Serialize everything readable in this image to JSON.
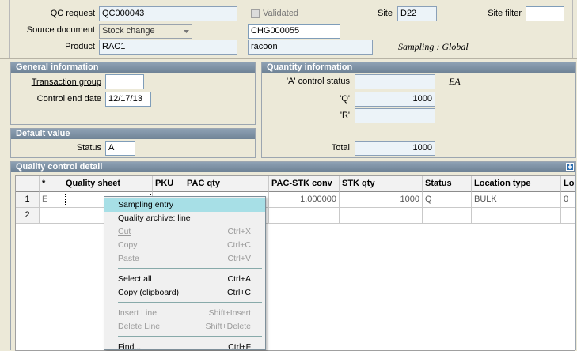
{
  "header": {
    "qc_request_label": "QC request",
    "qc_request_value": "QC000043",
    "validated_label": "Validated",
    "site_label": "Site",
    "site_value": "D22",
    "site_filter_label": "Site filter",
    "site_filter_value": "",
    "source_document_label": "Source document",
    "source_document_value": "Stock change",
    "source_ref_value": "CHG000055",
    "product_label": "Product",
    "product_value": "RAC1",
    "product_desc": "racoon",
    "sampling_text": "Sampling : Global"
  },
  "general_information": {
    "title": "General information",
    "transaction_group_label": "Transaction group",
    "transaction_group_value": "",
    "control_end_date_label": "Control end date",
    "control_end_date_value": "12/17/13"
  },
  "quantity_information": {
    "title": "Quantity information",
    "a_status_label": "'A' control status",
    "a_status_value": "",
    "a_unit": "EA",
    "q_label": "'Q'",
    "q_value": "1000",
    "r_label": "'R'",
    "r_value": "",
    "total_label": "Total",
    "total_value": "1000"
  },
  "default_value": {
    "title": "Default value",
    "status_label": "Status",
    "status_value": "A"
  },
  "qc_detail": {
    "title": "Quality control detail",
    "columns": [
      "*",
      "Quality sheet",
      "PKU",
      "PAC qty",
      "PAC-STK conv",
      "STK qty",
      "Status",
      "Location type",
      "Lo"
    ],
    "rows": [
      {
        "num": "1",
        "star": "E",
        "quality_sheet": "",
        "pku": "",
        "pac_qty": "",
        "pac_stk_conv": "1.000000",
        "stk_qty": "1000",
        "status": "Q",
        "location_type": "BULK",
        "lo": "0"
      },
      {
        "num": "2",
        "star": "",
        "quality_sheet": "",
        "pku": "",
        "pac_qty": "",
        "pac_stk_conv": "",
        "stk_qty": "",
        "status": "",
        "location_type": "",
        "lo": ""
      }
    ]
  },
  "context_menu": {
    "items": [
      {
        "label": "Sampling entry",
        "shortcut": "",
        "enabled": true,
        "highlighted": true
      },
      {
        "label": "Quality archive: line",
        "shortcut": "",
        "enabled": true,
        "highlighted": false
      },
      {
        "label": "Cut",
        "shortcut": "Ctrl+X",
        "enabled": false
      },
      {
        "label": "Copy",
        "shortcut": "Ctrl+C",
        "enabled": false
      },
      {
        "label": "Paste",
        "shortcut": "Ctrl+V",
        "enabled": false
      },
      {
        "label": "Select all",
        "shortcut": "Ctrl+A",
        "enabled": true
      },
      {
        "label": "Copy (clipboard)",
        "shortcut": "Ctrl+C",
        "enabled": true
      },
      {
        "label": "Insert Line",
        "shortcut": "Shift+Insert",
        "enabled": false
      },
      {
        "label": "Delete Line",
        "shortcut": "Shift+Delete",
        "enabled": false
      },
      {
        "label": "Find...",
        "shortcut": "Ctrl+F",
        "enabled": true
      }
    ]
  }
}
